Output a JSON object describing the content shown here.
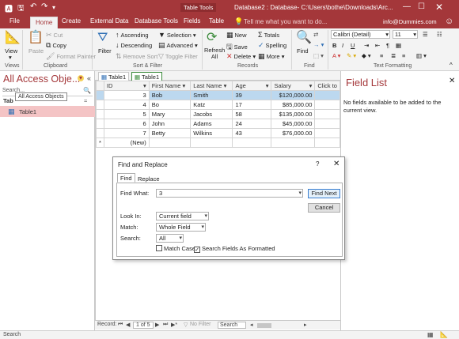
{
  "window": {
    "context_label": "Table Tools",
    "title": "Database2 : Database- C:\\Users\\bothe\\Downloads\\Arc...",
    "help_prompt": "Tell me what you want to do...",
    "user_email": "info@Dummies.com"
  },
  "menu_tabs": [
    "File",
    "Home",
    "Create",
    "External Data",
    "Database Tools",
    "Fields",
    "Table"
  ],
  "ribbon": {
    "views": {
      "view_label": "View",
      "group_label": "Views"
    },
    "clipboard": {
      "paste_label": "Paste",
      "cut_label": "Cut",
      "copy_label": "Copy",
      "format_painter_label": "Format Painter",
      "group_label": "Clipboard"
    },
    "sort_filter": {
      "filter_label": "Filter",
      "ascending_label": "Ascending",
      "descending_label": "Descending",
      "remove_sort_label": "Remove Sort",
      "selection_label": "Selection",
      "advanced_label": "Advanced",
      "toggle_filter_label": "Toggle Filter",
      "group_label": "Sort & Filter"
    },
    "records": {
      "refresh_label": "Refresh All",
      "new_label": "New",
      "save_label": "Save",
      "delete_label": "Delete",
      "totals_label": "Totals",
      "spelling_label": "Spelling",
      "more_label": "More",
      "group_label": "Records"
    },
    "find": {
      "find_label": "Find",
      "group_label": "Find"
    },
    "text_formatting": {
      "font_name": "Calibri (Detail)",
      "font_size": "11",
      "group_label": "Text Formatting"
    }
  },
  "nav_pane": {
    "title": "All Access Obje...",
    "tooltip": "All Access Objects",
    "search_placeholder": "Search...",
    "section_label": "Tab",
    "items": [
      "Table1"
    ]
  },
  "document_tabs": [
    "Table1",
    "Table1"
  ],
  "datasheet": {
    "columns": [
      "ID",
      "First Name",
      "Last Name",
      "Age",
      "Salary",
      "Click to"
    ],
    "rows": [
      {
        "id": "3",
        "first": "Bob",
        "last": "Smith",
        "age": "39",
        "salary": "$120,000.00"
      },
      {
        "id": "4",
        "first": "Bo",
        "last": "Katz",
        "age": "17",
        "salary": "$85,000.00"
      },
      {
        "id": "5",
        "first": "Mary",
        "last": "Jacobs",
        "age": "58",
        "salary": "$135,000.00"
      },
      {
        "id": "6",
        "first": "John",
        "last": "Adams",
        "age": "24",
        "salary": "$45,000.00"
      },
      {
        "id": "7",
        "first": "Betty",
        "last": "Wilkins",
        "age": "43",
        "salary": "$76,000.00"
      }
    ],
    "new_row_marker": "*",
    "new_row_label": "(New)"
  },
  "record_nav": {
    "label": "Record:",
    "position": "1 of 5",
    "filter_label": "No Filter",
    "search_label": "Search"
  },
  "field_list": {
    "title": "Field List",
    "message": "No fields available to be added to the current view."
  },
  "status_bar": {
    "text": "Search"
  },
  "dialog": {
    "title": "Find and Replace",
    "help": "?",
    "tabs": [
      "Find",
      "Replace"
    ],
    "find_what_label": "Find What:",
    "find_what_value": "3",
    "look_in_label": "Look In:",
    "look_in_value": "Current field",
    "match_label": "Match:",
    "match_value": "Whole Field",
    "search_label": "Search:",
    "search_value": "All",
    "match_case_label": "Match Case",
    "match_case_checked": false,
    "format_label": "Search Fields As Formatted",
    "format_checked": true,
    "find_next_label": "Find Next",
    "cancel_label": "Cancel"
  },
  "colors": {
    "accent": "#a4373a",
    "selection": "#bcd8ef",
    "nav_selected": "#f4c4c5"
  }
}
